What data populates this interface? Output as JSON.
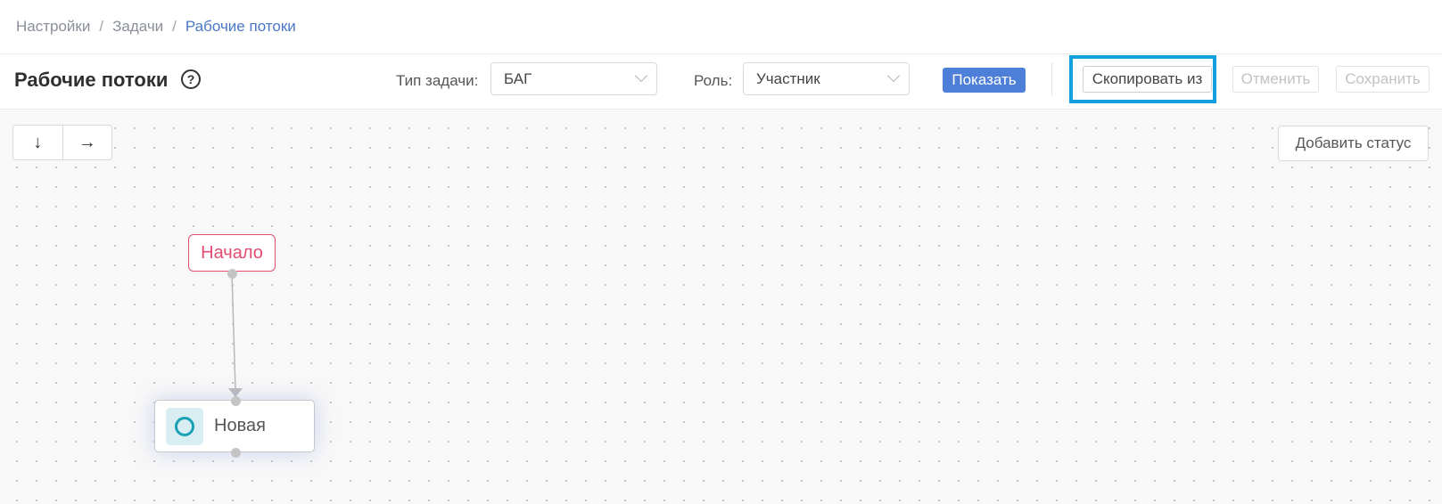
{
  "breadcrumb": {
    "items": [
      "Настройки",
      "Задачи"
    ],
    "current": "Рабочие потоки",
    "separator": "/"
  },
  "header": {
    "title": "Рабочие потоки",
    "help_icon": "?"
  },
  "filters": {
    "task_type": {
      "label": "Тип задачи:",
      "value": "БАГ"
    },
    "role": {
      "label": "Роль:",
      "value": "Участник"
    },
    "show_label": "Показать"
  },
  "actions": {
    "copy_from": "Скопировать из",
    "cancel": "Отменить",
    "save": "Сохранить"
  },
  "canvas": {
    "dir_down": "↓",
    "dir_right": "→",
    "add_status": "Добавить статус",
    "start_node": "Начало",
    "states": [
      {
        "label": "Новая"
      }
    ]
  },
  "colors": {
    "accent": "#4e7fd8",
    "highlight": "#12a0df",
    "start": "#e24d70",
    "state_icon": "#1aa1b6"
  }
}
